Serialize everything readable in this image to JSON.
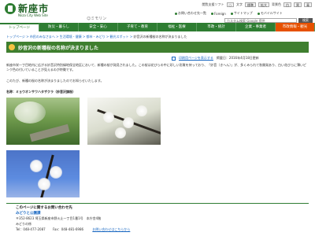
{
  "header": {
    "site_name": "新座市",
    "site_sub": "Niiza City Web Site",
    "mascot": "☺ミモリン",
    "row1": {
      "label": "閲覧支援ソフト",
      "buttons": [
        "○",
        "文字",
        "標準",
        "拡大",
        "背景色",
        "白",
        "黒",
        "青"
      ]
    },
    "row2_links": [
      "お問い合わせ先一覧",
      "Foreign",
      "サイトマップ",
      "モバイルサイト"
    ],
    "search_placeholder": "カスタム検索 Google 提供",
    "search_button": "検索"
  },
  "nav": {
    "items": [
      "トップページ",
      "防災・暮らし",
      "安全・安心",
      "子育て・教育",
      "福祉・医療",
      "市政・統計",
      "企業・事業者",
      "市政情報・観光"
    ]
  },
  "breadcrumb": {
    "items": [
      "トップページ",
      "市民のみなさまへ",
      "生活環境・健康",
      "都市・みどり",
      "観光スポット"
    ],
    "current": "妙音沢の新種桜の名称が決まりました"
  },
  "page": {
    "title": "妙音沢の新種桜の名称が決まりました",
    "print_link": "印刷用ページを表示する",
    "date": "掲載日：2016年4月18日更新",
    "paragraph1": "新座市栄一丁目地内に広がる妙音沢特別緑地保全地区において、新種の桜が発見されました。この桜は花びらの中に珍しい形質を持っており、「妙音（きへん）」が、多くみられて秋開発あり、白い花びらに薄いピンク色の付いていることが見えるのが特徴です。",
    "paragraph2": "このたび、新種の桜の名称が決まりましたのでお知らせいたします。",
    "caption": "名称：ミョウオンサワハタザクラ（妙音沢旗桜）"
  },
  "contact": {
    "heading": "このページに関するお問い合わせ先",
    "dept": "みどりと公園課",
    "address": "〒352-8623 埼玉県新座市野火止一丁目1番1号　本庁舎4階",
    "section": "みどりの係",
    "tel": "Tel：048-477-2087",
    "fax": "Fax：048-481-6986",
    "link": "お問い合わせはこちらから"
  },
  "colors": {
    "brand_green": "#2e7d32",
    "title_band": "#3f7f2f",
    "link_blue": "#1565c0",
    "nav_accent": "#e65100"
  }
}
